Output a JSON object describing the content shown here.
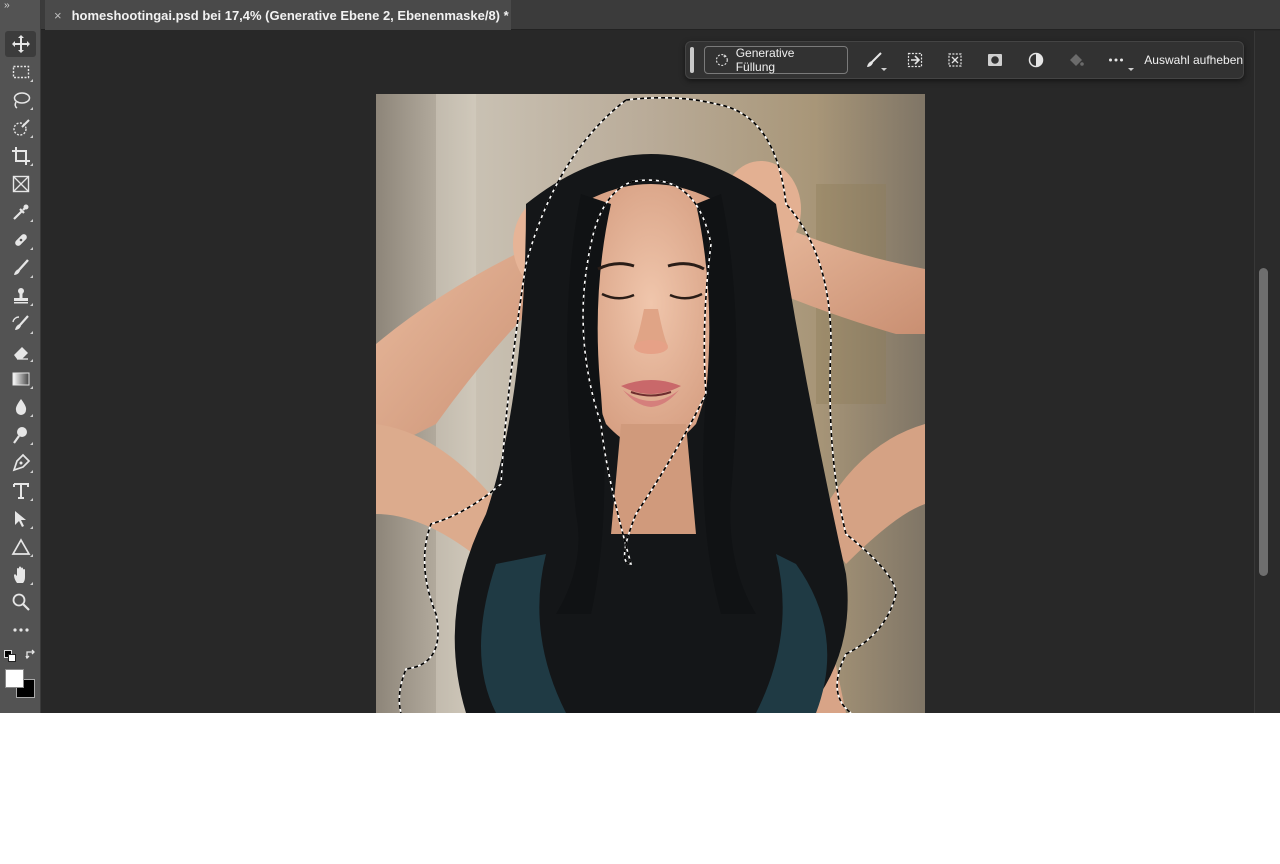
{
  "document": {
    "tab_title": "homeshootingai.psd bei 17,4% (Generative Ebene 2, Ebenenmaske/8) *",
    "close_glyph": "×"
  },
  "toolbar": {
    "collapse_glyph": "››",
    "tools": [
      {
        "icon": "move-icon",
        "active": true
      },
      {
        "icon": "rectangular-marquee-icon"
      },
      {
        "icon": "lasso-icon"
      },
      {
        "icon": "object-selection-icon"
      },
      {
        "icon": "crop-icon"
      },
      {
        "icon": "frame-icon"
      },
      {
        "icon": "eyedropper-icon"
      },
      {
        "icon": "healing-brush-icon"
      },
      {
        "icon": "brush-icon"
      },
      {
        "icon": "clone-stamp-icon"
      },
      {
        "icon": "history-brush-icon"
      },
      {
        "icon": "eraser-icon"
      },
      {
        "icon": "gradient-icon"
      },
      {
        "icon": "blur-icon"
      },
      {
        "icon": "dodge-icon"
      },
      {
        "icon": "pen-icon"
      },
      {
        "icon": "type-icon"
      },
      {
        "icon": "path-selection-icon"
      },
      {
        "icon": "shape-icon"
      },
      {
        "icon": "hand-icon"
      },
      {
        "icon": "zoom-icon"
      },
      {
        "icon": "more-tools-icon"
      }
    ],
    "foreground_color": "#ffffff",
    "background_color": "#000000"
  },
  "taskbar": {
    "generative_fill_label": "Generative Füllung",
    "deselect_label": "Auswahl aufheben",
    "icons": [
      "brush-mask-icon",
      "invert-selection-icon",
      "transform-selection-icon",
      "mask-icon",
      "fill-adjust-icon",
      "fill-bucket-icon",
      "more-options-icon"
    ]
  },
  "colors": {
    "workspace": "#282828",
    "panel": "#535353",
    "accent_text": "#f0f0f0"
  }
}
